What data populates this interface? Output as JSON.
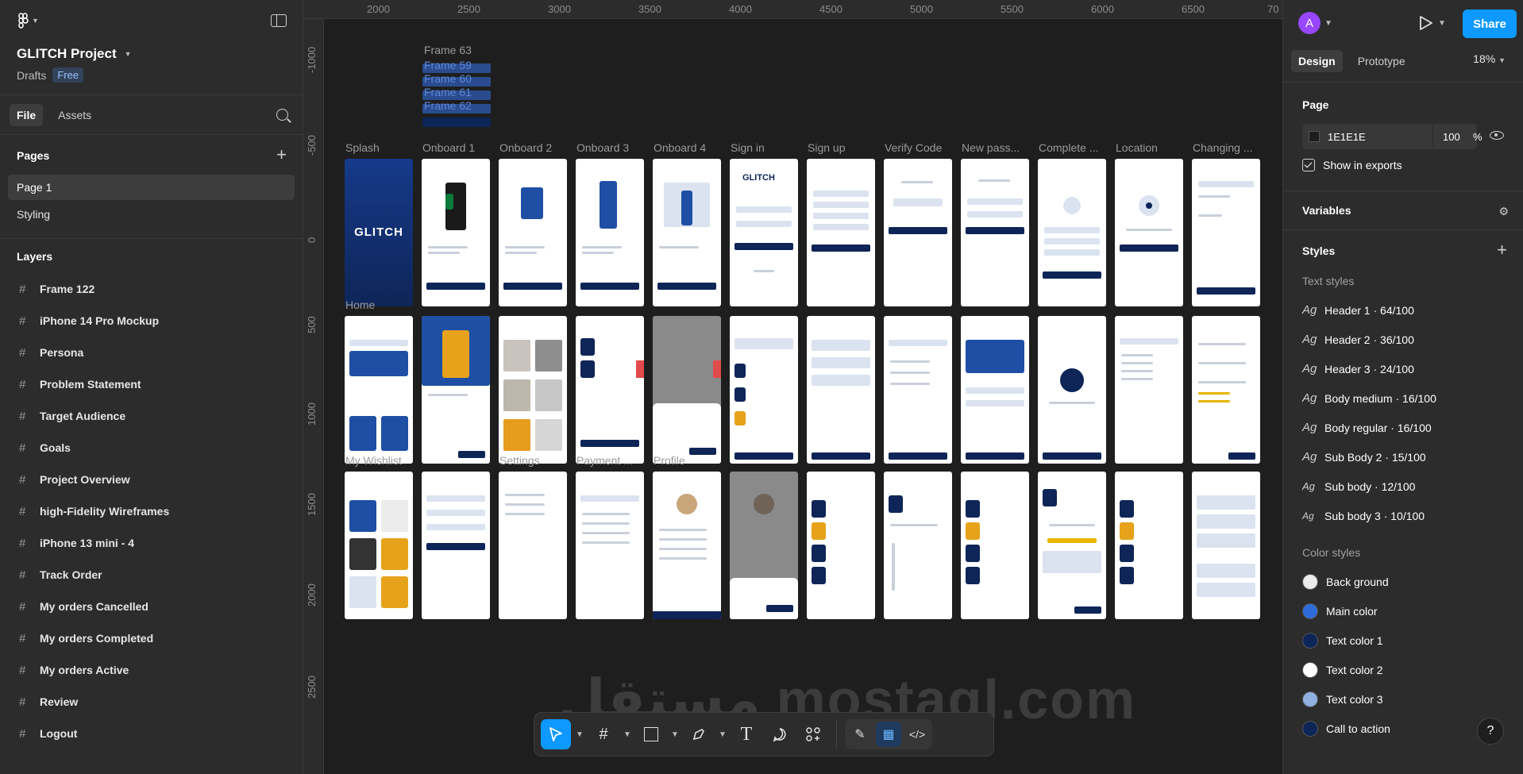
{
  "left_panel": {
    "project_title": "GLITCH Project",
    "location": "Drafts",
    "plan_badge": "Free",
    "tabs": [
      "File",
      "Assets"
    ],
    "pages_header": "Pages",
    "pages": [
      "Page 1",
      "Styling"
    ],
    "layers_header": "Layers",
    "layers": [
      "Frame 122",
      "iPhone 14 Pro Mockup",
      "Persona",
      "Problem Statement",
      "Target Audience",
      "Goals",
      "Project Overview",
      "high-Fidelity Wireframes",
      "iPhone 13 mini - 4",
      "Track Order",
      "My orders Cancelled",
      "My orders Completed",
      "My orders Active",
      "Review",
      "Logout"
    ]
  },
  "canvas": {
    "ruler_x": [
      "2000",
      "2500",
      "3000",
      "3500",
      "4000",
      "4500",
      "5000",
      "5500",
      "6000",
      "6500",
      "70"
    ],
    "ruler_y": [
      "-1000",
      "-500",
      "0",
      "500",
      "1000",
      "1500",
      "2000",
      "2500"
    ],
    "stacked_frames": [
      "Frame 63",
      "Frame 59",
      "Frame 60",
      "Frame 61",
      "Frame 62"
    ],
    "row1_labels": [
      "Splash",
      "Onboard 1",
      "Onboard 2",
      "Onboard 3",
      "Onboard 4",
      "Sign in",
      "Sign up",
      "Verify Code",
      "New pass...",
      "Complete ...",
      "Location",
      "Changing ..."
    ],
    "row2_labels": [
      "Home"
    ],
    "row3_labels": [
      "My Wishlist",
      "Settings",
      "Payment ...",
      "Profile"
    ],
    "splash_text": "GLITCH",
    "watermark": "مستقل mostaql.com"
  },
  "toolbar": {
    "tools": [
      "move-tool",
      "frame-tool",
      "shape-tool",
      "pen-tool",
      "text-tool",
      "comment-tool",
      "actions-tool"
    ],
    "dev_tools": [
      "draw-mode",
      "design-mode",
      "dev-mode"
    ]
  },
  "right_panel": {
    "avatar_letter": "A",
    "share_label": "Share",
    "tabs": [
      "Design",
      "Prototype"
    ],
    "zoom": "18%",
    "page_section": "Page",
    "page_color": "1E1E1E",
    "page_opacity": "100",
    "pct": "%",
    "show_in_exports": "Show in exports",
    "variables": "Variables",
    "styles": "Styles",
    "text_styles_header": "Text styles",
    "text_styles": [
      "Header 1 · 64/100",
      "Header 2 · 36/100",
      "Header 3 · 24/100",
      "Body medium · 16/100",
      "Body regular · 16/100",
      "Sub Body 2 · 15/100",
      "Sub body · 12/100",
      "Sub body 3 · 10/100"
    ],
    "color_styles_header": "Color styles",
    "color_styles": [
      {
        "name": "Back ground",
        "color": "#ECECEC"
      },
      {
        "name": "Main color",
        "color": "#2F6BD8"
      },
      {
        "name": "Text color 1",
        "color": "#0E2557"
      },
      {
        "name": "Text color 2",
        "color": "#FFFFFF"
      },
      {
        "name": "Text color 3",
        "color": "#8FB0E0"
      },
      {
        "name": "Call to action",
        "color": "#0E2557"
      }
    ],
    "help": "?"
  }
}
